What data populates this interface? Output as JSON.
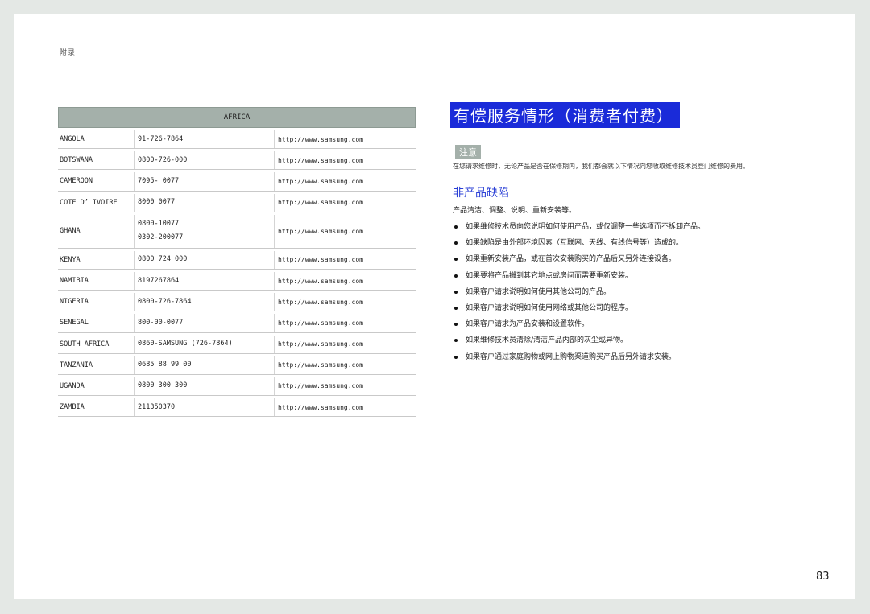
{
  "header": {
    "label": "附录"
  },
  "table": {
    "title": "AFRICA",
    "rows": [
      {
        "country": "ANGOLA",
        "phones": [
          "91-726-7864"
        ],
        "web": "http://www.samsung.com"
      },
      {
        "country": "BOTSWANA",
        "phones": [
          "0800-726-000"
        ],
        "web": "http://www.samsung.com"
      },
      {
        "country": "CAMEROON",
        "phones": [
          "7095- 0077"
        ],
        "web": "http://www.samsung.com"
      },
      {
        "country": "COTE D’ IVOIRE",
        "phones": [
          "8000 0077"
        ],
        "web": "http://www.samsung.com"
      },
      {
        "country": "GHANA",
        "phones": [
          "0800-10077",
          "0302-200077"
        ],
        "web": "http://www.samsung.com"
      },
      {
        "country": "KENYA",
        "phones": [
          "0800 724 000"
        ],
        "web": "http://www.samsung.com"
      },
      {
        "country": "NAMIBIA",
        "phones": [
          "8197267864"
        ],
        "web": "http://www.samsung.com"
      },
      {
        "country": "NIGERIA",
        "phones": [
          "0800-726-7864"
        ],
        "web": "http://www.samsung.com"
      },
      {
        "country": "SENEGAL",
        "phones": [
          "800-00-0077"
        ],
        "web": "http://www.samsung.com"
      },
      {
        "country": "SOUTH AFRICA",
        "phones": [
          "0860-SAMSUNG (726-7864)"
        ],
        "web": "http://www.samsung.com"
      },
      {
        "country": "TANZANIA",
        "phones": [
          "0685 88 99 00"
        ],
        "web": "http://www.samsung.com"
      },
      {
        "country": "UGANDA",
        "phones": [
          "0800 300 300"
        ],
        "web": "http://www.samsung.com"
      },
      {
        "country": "ZAMBIA",
        "phones": [
          "211350370"
        ],
        "web": "http://www.samsung.com"
      }
    ]
  },
  "section": {
    "title": "有偿服务情形（消费者付费）",
    "note_label": "注意",
    "note_text": "在您请求维修时，无论产品是否在保修期内，我们都会就以下情况向您收取维修技术员登门维修的费用。",
    "subheading": "非产品缺陷",
    "intro": "产品清洁、调整、说明、重新安装等。",
    "bullets": [
      "如果维修技术员向您说明如何使用产品，或仅调整一些选项而不拆卸产品。",
      "如果缺陷是由外部环境因素（互联网、天线、有线信号等）造成的。",
      "如果重新安装产品，或在首次安装购买的产品后又另外连接设备。",
      "如果要将产品搬到其它地点或房间而需要重新安装。",
      "如果客户请求说明如何使用其他公司的产品。",
      "如果客户请求说明如何使用网络或其他公司的程序。",
      "如果客户请求为产品安装和设置软件。",
      "如果维修技术员清除/清洁产品内部的灰尘或异物。",
      "如果客户通过家庭购物或网上购物渠道购买产品后另外请求安装。"
    ]
  },
  "page_number": "83",
  "colors": {
    "title_bg": "#1a2bd9",
    "subheading": "#2a3fd6",
    "badge_bg": "#a4b0aa",
    "table_head_bg": "#a4b0aa"
  }
}
